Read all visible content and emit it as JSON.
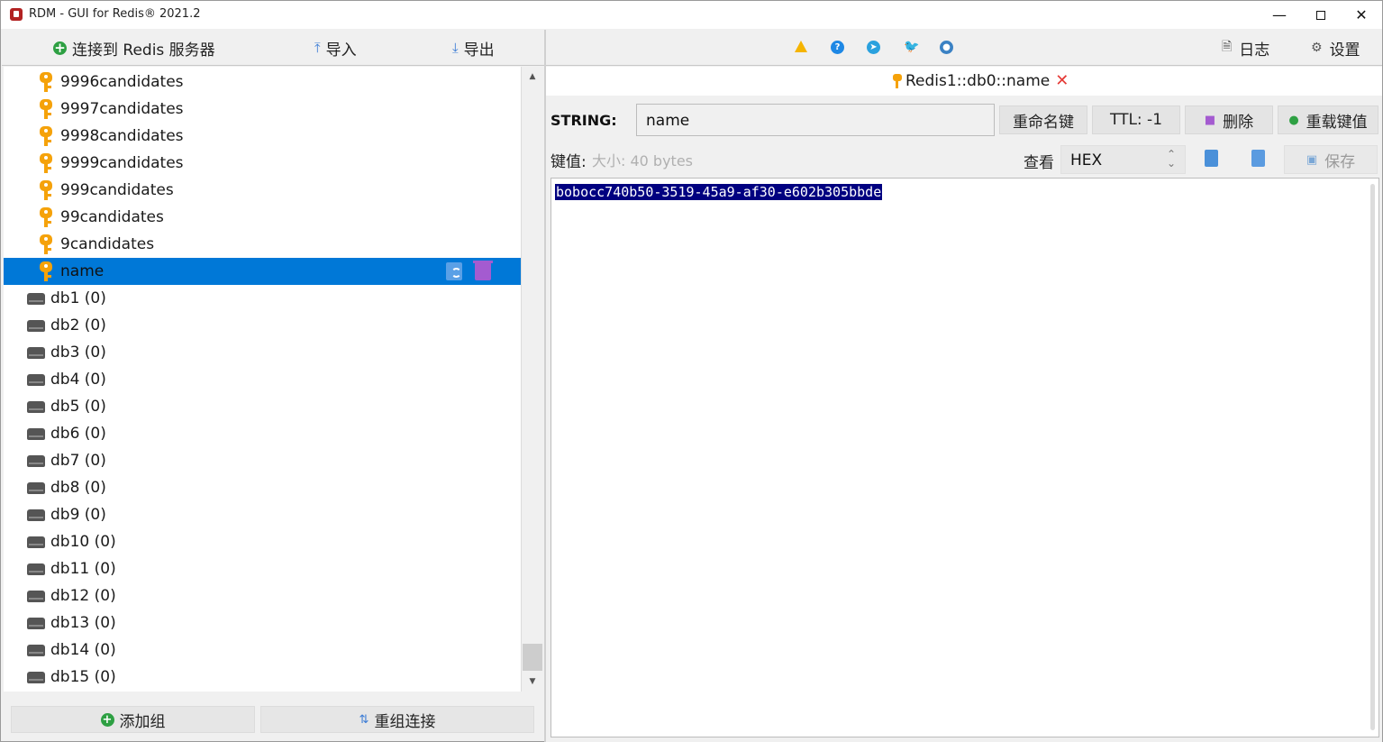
{
  "window": {
    "title": "RDM - GUI for Redis® 2021.2",
    "minimize": "—",
    "close": "✕"
  },
  "left_toolbar": {
    "connect_label": "连接到 Redis 服务器",
    "import_label": "导入",
    "export_label": "导出"
  },
  "tree": {
    "keys": [
      {
        "label": "9996candidates",
        "selected": false
      },
      {
        "label": "9997candidates",
        "selected": false
      },
      {
        "label": "9998candidates",
        "selected": false
      },
      {
        "label": "9999candidates",
        "selected": false
      },
      {
        "label": "999candidates",
        "selected": false
      },
      {
        "label": "99candidates",
        "selected": false
      },
      {
        "label": "9candidates",
        "selected": false
      },
      {
        "label": "name",
        "selected": true
      }
    ],
    "databases": [
      {
        "label": "db1  (0)"
      },
      {
        "label": "db2  (0)"
      },
      {
        "label": "db3  (0)"
      },
      {
        "label": "db4  (0)"
      },
      {
        "label": "db5  (0)"
      },
      {
        "label": "db6  (0)"
      },
      {
        "label": "db7  (0)"
      },
      {
        "label": "db8  (0)"
      },
      {
        "label": "db9  (0)"
      },
      {
        "label": "db10  (0)"
      },
      {
        "label": "db11  (0)"
      },
      {
        "label": "db12  (0)"
      },
      {
        "label": "db13  (0)"
      },
      {
        "label": "db14  (0)"
      },
      {
        "label": "db15  (0)"
      }
    ]
  },
  "bottom_left": {
    "add_group_label": "添加组",
    "regroup_label": "重组连接"
  },
  "right_toolbar": {
    "log_label": "日志",
    "settings_label": "设置"
  },
  "tab": {
    "label": "Redis1::db0::name"
  },
  "key_panel": {
    "type_label": "STRING:",
    "key_name": "name",
    "rename_label": "重命名键",
    "ttl_label": "TTL:  -1",
    "delete_label": "删除",
    "reload_label": "重载键值",
    "value_label": "键值:",
    "size_label": "大小: 40 bytes",
    "view_label": "查看",
    "view_mode": "HEX",
    "save_label": "保存",
    "value": "bobocc740b50-3519-45a9-af30-e602b305bbde"
  },
  "colors": {
    "selection": "#0078d7",
    "key_icon": "#f5a20a",
    "value_highlight": "#000080"
  }
}
